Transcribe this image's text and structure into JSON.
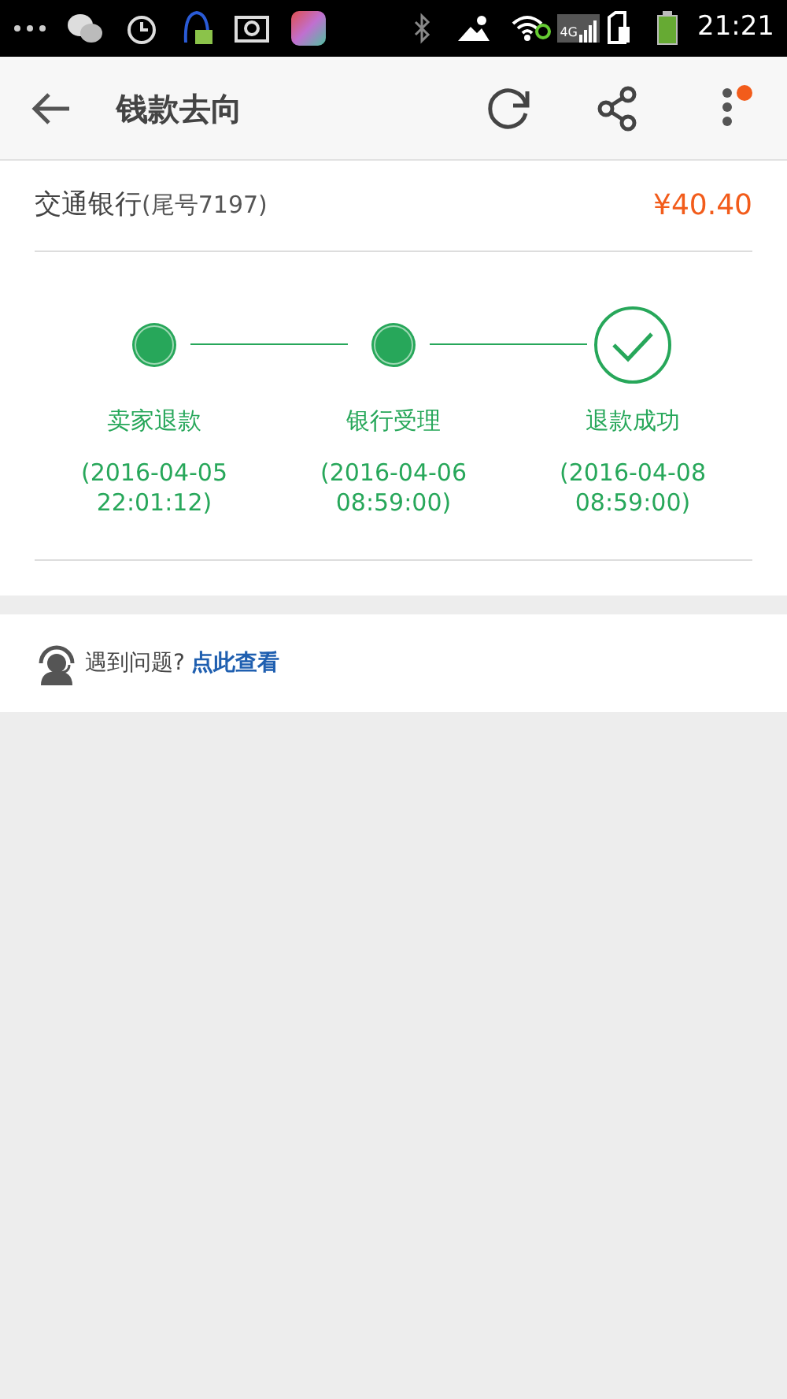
{
  "status_bar": {
    "time": "21:21",
    "network": "4G"
  },
  "header": {
    "title": "钱款去向",
    "menu_badge": true
  },
  "account": {
    "bank": "交通银行",
    "tail": "(尾号7197)",
    "amount": "¥40.40"
  },
  "steps": [
    {
      "kind": "dot",
      "label": "卖家退款",
      "date": "(2016-04-05",
      "time": "22:01:12)"
    },
    {
      "kind": "dot",
      "label": "银行受理",
      "date": "(2016-04-06",
      "time": "08:59:00)"
    },
    {
      "kind": "check",
      "label": "退款成功",
      "date": "(2016-04-08",
      "time": "08:59:00)"
    }
  ],
  "help": {
    "question": "遇到问题?",
    "link": "点此查看"
  }
}
